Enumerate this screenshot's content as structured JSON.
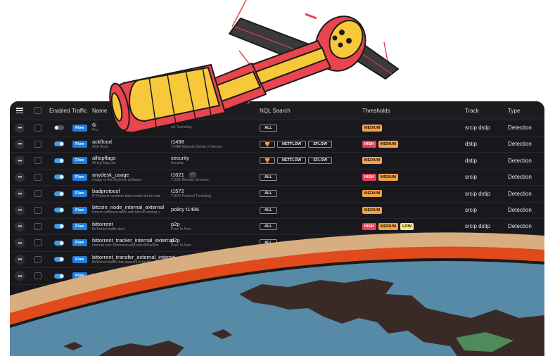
{
  "table": {
    "headers": {
      "enabled": "Enabled",
      "traffic": "Traffic",
      "name": "Name",
      "nql": "NQL Search",
      "thresholds": "Thresholds",
      "track": "Track",
      "type": "Type"
    },
    "rows": [
      {
        "enabled": false,
        "flow": "Flow",
        "name": "6i",
        "desc": "Pro",
        "nql_main": "",
        "nql_sub": "col Tunneling",
        "search": [
          "ALL"
        ],
        "thresholds": [
          "MEDIUM"
        ],
        "track": "srcip  dstip",
        "type": "Detection"
      },
      {
        "enabled": true,
        "flow": "Flow",
        "name": "ackflood",
        "desc": "ACK flood",
        "nql_main": "t1498",
        "nql_sub": "T1498 Network Denial of Service",
        "search": [
          "trophy",
          "NETFLOW",
          "SFLOW"
        ],
        "thresholds": [
          "HIGH",
          "MEDIUM"
        ],
        "track": "dstip",
        "type": "Detection"
      },
      {
        "enabled": true,
        "flow": "Flow",
        "name": "alltcpflags",
        "desc": "All tcp flags set",
        "nql_main": "security",
        "nql_sub": "Security",
        "search": [
          "trophy",
          "NETFLOW",
          "SFLOW"
        ],
        "thresholds": [
          "MEDIUM"
        ],
        "track": "dstip",
        "type": "Detection"
      },
      {
        "enabled": true,
        "flow": "Flow",
        "name": "anydesk_usage",
        "desc": "Usage of the AnyDesk software",
        "nql_main": "t1021",
        "nql_sub": "T1021 Remote Services",
        "plus": "+1",
        "search": [
          "ALL"
        ],
        "thresholds": [
          "HIGH",
          "MEDIUM"
        ],
        "track": "srcip",
        "type": "Detection"
      },
      {
        "enabled": true,
        "flow": "Flow",
        "name": "badprotocol",
        "desc": "IP Protocol numbers that should not be rout",
        "nql_main": "t1572",
        "nql_sub": "T1572 Protocol Tunneling",
        "search": [
          "ALL"
        ],
        "thresholds": [
          "MEDIUM"
        ],
        "track": "srcip  dstip",
        "type": "Detection"
      },
      {
        "enabled": true,
        "flow": "Flow",
        "name": "bitcoin_node_internal_external",
        "desc": "Detect communication with bitcoin mining n",
        "nql_main": "policy  t1496",
        "nql_sub": "",
        "search": [
          "ALL"
        ],
        "thresholds": [
          "MEDIUM"
        ],
        "track": "srcip",
        "type": "Detection"
      },
      {
        "enabled": true,
        "flow": "Flow",
        "name": "bittorrent",
        "desc": "BitTorrent traffic alert",
        "nql_main": "p2p",
        "nql_sub": "Peer To Peer",
        "search": [
          "ALL"
        ],
        "thresholds": [
          "HIGH",
          "MEDIUM",
          "LOW"
        ],
        "track": "srcip  dstip",
        "type": "Detection"
      },
      {
        "enabled": true,
        "flow": "Flow",
        "name": "bittorrent_tracker_internal_external",
        "desc": "Internal host communicated with BitTorrent",
        "nql_main": "p2p",
        "nql_sub": "Peer To Peer",
        "search": [
          "ALL"
        ],
        "thresholds": [],
        "track": "",
        "type": ""
      },
      {
        "enabled": true,
        "flow": "Flow",
        "name": "bittorrent_transfer_external_internal",
        "desc": "BitTorrent traffic that appears to be file",
        "nql_main": "p2p",
        "nql_sub": "",
        "search": [],
        "thresholds": [],
        "track": "",
        "type": ""
      },
      {
        "enabled": true,
        "flow": "Flow",
        "name": "bittorrent_",
        "desc": "",
        "nql_main": "",
        "nql_sub": "",
        "search": [],
        "thresholds": [],
        "track": "",
        "type": ""
      }
    ]
  },
  "illustration": {
    "subject": "satellite-over-earth",
    "colors": {
      "sky": "#d8ae80",
      "atmosphere": "#e04a1c",
      "ocean": "#578aa6",
      "land": "#3a2a26",
      "hull_red": "#e8454f",
      "hull_yellow": "#f7c83a",
      "outline": "#1a1a1a"
    }
  }
}
